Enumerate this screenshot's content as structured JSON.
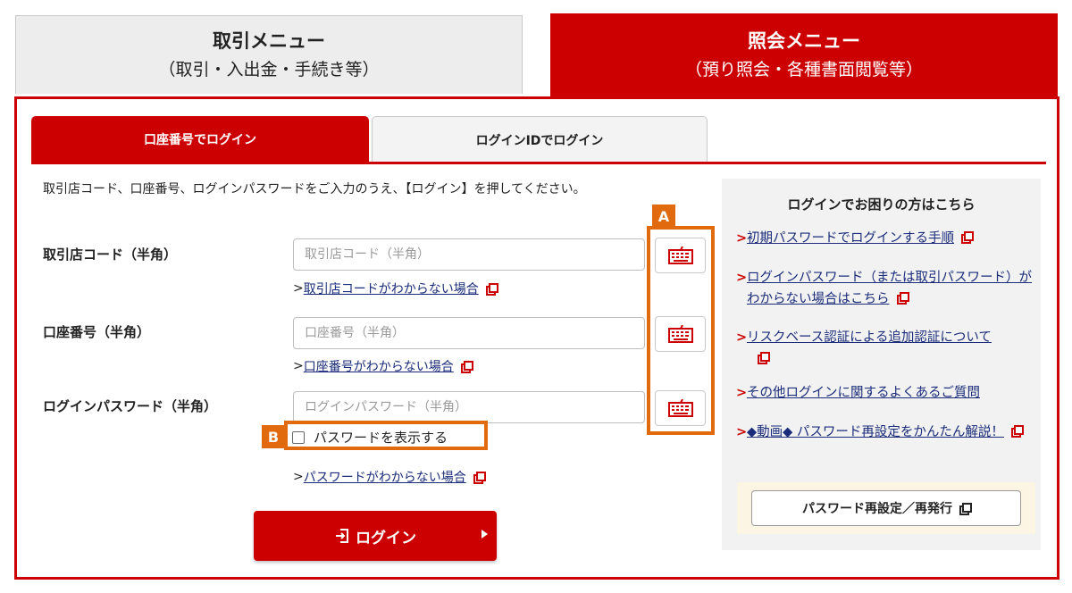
{
  "top_tabs": {
    "trade": {
      "title": "取引メニュー",
      "subtitle": "（取引・入出金・手続き等）"
    },
    "inquiry": {
      "title": "照会メニュー",
      "subtitle": "（預り照会・各種書面閲覧等）"
    }
  },
  "login_tabs": {
    "account": "口座番号でログイン",
    "login_id": "ログインIDでログイン"
  },
  "instruction": "取引店コード、口座番号、ログインパスワードをご入力のうえ、【ログイン】を押してください。",
  "fields": {
    "branch": {
      "label": "取引店コード（半角）",
      "placeholder": "取引店コード（半角）",
      "help": "取引店コードがわからない場合"
    },
    "account": {
      "label": "口座番号（半角）",
      "placeholder": "口座番号（半角）",
      "help": "口座番号がわからない場合"
    },
    "password": {
      "label": "ログインパスワード（半角）",
      "placeholder": "ログインパスワード（半角）",
      "help": "パスワードがわからない場合"
    }
  },
  "help_prefix": ">",
  "show_password_label": "パスワードを表示する",
  "login_button": "ログイン",
  "annotations": {
    "a": "A",
    "b": "B"
  },
  "help_panel": {
    "title": "ログインでお困りの方はこちら",
    "items": [
      "初期パスワードでログインする手順",
      "ログインパスワード（または取引パスワード）がわからない場合はこちら",
      "リスクベース認証による追加認証について",
      "その他ログインに関するよくあるご質問",
      "◆動画◆ パスワード再設定をかんたん解説！"
    ],
    "chevron": ">",
    "reset_button": "パスワード再設定／再発行"
  },
  "colors": {
    "brand_red": "#cc0000",
    "annotation_orange": "#e06a0d",
    "link_blue": "#1a2c7a"
  },
  "icons": {
    "keyboard": "software-keyboard-icon",
    "external": "external-link-icon"
  }
}
